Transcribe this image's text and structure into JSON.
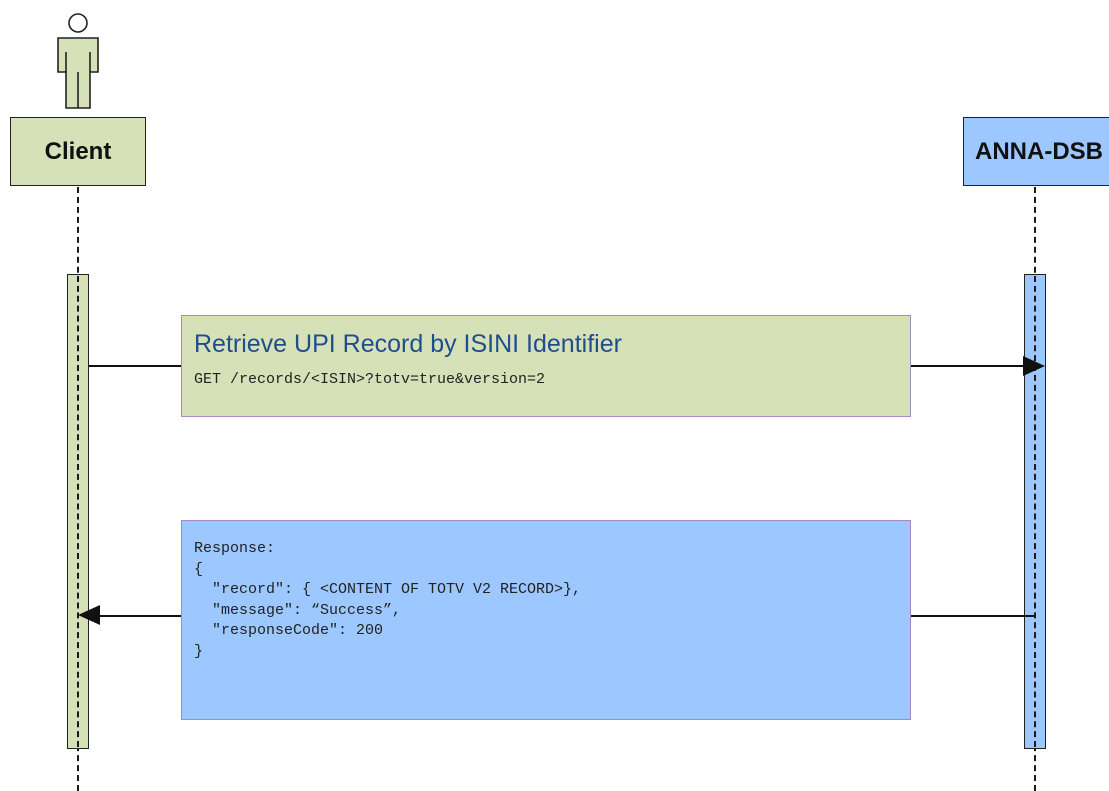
{
  "participants": [
    {
      "name": "Client",
      "color": "#d6e1b8"
    },
    {
      "name": "ANNA-DSB",
      "color": "#9dc8ff"
    }
  ],
  "request": {
    "title": "Retrieve UPI Record by ISINI Identifier",
    "endpoint": "GET /records/<ISIN>?totv=true&version=2",
    "color": "#d6e1b8"
  },
  "response": {
    "lines": [
      "Response:",
      "{",
      "  \"record\": { <CONTENT OF TOTV V2 RECORD>},",
      "  \"message\": “Success”,",
      "  \"responseCode\": 200",
      "}"
    ],
    "color": "#9dc8ff"
  },
  "icons": {
    "actor": "actor-icon"
  }
}
